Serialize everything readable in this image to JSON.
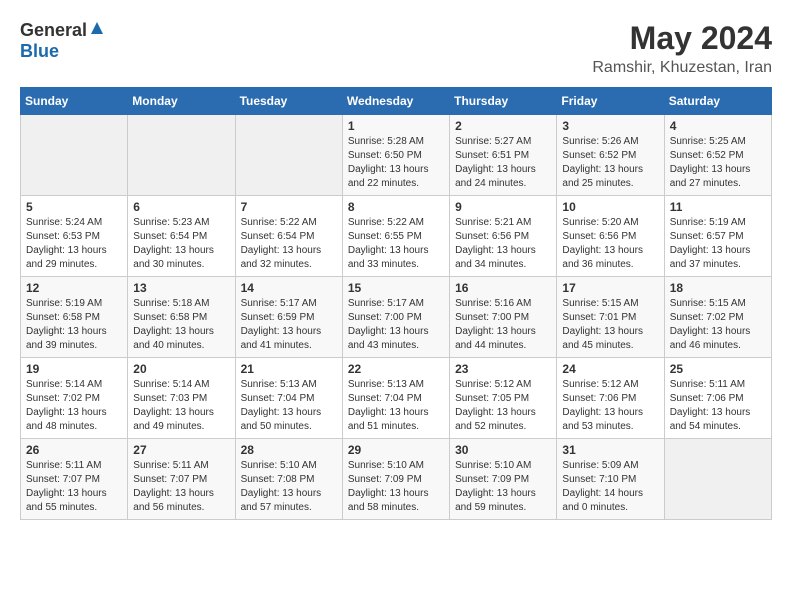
{
  "logo": {
    "general": "General",
    "blue": "Blue"
  },
  "title": "May 2024",
  "location": "Ramshir, Khuzestan, Iran",
  "headers": [
    "Sunday",
    "Monday",
    "Tuesday",
    "Wednesday",
    "Thursday",
    "Friday",
    "Saturday"
  ],
  "weeks": [
    [
      {
        "day": "",
        "info": ""
      },
      {
        "day": "",
        "info": ""
      },
      {
        "day": "",
        "info": ""
      },
      {
        "day": "1",
        "info": "Sunrise: 5:28 AM\nSunset: 6:50 PM\nDaylight: 13 hours\nand 22 minutes."
      },
      {
        "day": "2",
        "info": "Sunrise: 5:27 AM\nSunset: 6:51 PM\nDaylight: 13 hours\nand 24 minutes."
      },
      {
        "day": "3",
        "info": "Sunrise: 5:26 AM\nSunset: 6:52 PM\nDaylight: 13 hours\nand 25 minutes."
      },
      {
        "day": "4",
        "info": "Sunrise: 5:25 AM\nSunset: 6:52 PM\nDaylight: 13 hours\nand 27 minutes."
      }
    ],
    [
      {
        "day": "5",
        "info": "Sunrise: 5:24 AM\nSunset: 6:53 PM\nDaylight: 13 hours\nand 29 minutes."
      },
      {
        "day": "6",
        "info": "Sunrise: 5:23 AM\nSunset: 6:54 PM\nDaylight: 13 hours\nand 30 minutes."
      },
      {
        "day": "7",
        "info": "Sunrise: 5:22 AM\nSunset: 6:54 PM\nDaylight: 13 hours\nand 32 minutes."
      },
      {
        "day": "8",
        "info": "Sunrise: 5:22 AM\nSunset: 6:55 PM\nDaylight: 13 hours\nand 33 minutes."
      },
      {
        "day": "9",
        "info": "Sunrise: 5:21 AM\nSunset: 6:56 PM\nDaylight: 13 hours\nand 34 minutes."
      },
      {
        "day": "10",
        "info": "Sunrise: 5:20 AM\nSunset: 6:56 PM\nDaylight: 13 hours\nand 36 minutes."
      },
      {
        "day": "11",
        "info": "Sunrise: 5:19 AM\nSunset: 6:57 PM\nDaylight: 13 hours\nand 37 minutes."
      }
    ],
    [
      {
        "day": "12",
        "info": "Sunrise: 5:19 AM\nSunset: 6:58 PM\nDaylight: 13 hours\nand 39 minutes."
      },
      {
        "day": "13",
        "info": "Sunrise: 5:18 AM\nSunset: 6:58 PM\nDaylight: 13 hours\nand 40 minutes."
      },
      {
        "day": "14",
        "info": "Sunrise: 5:17 AM\nSunset: 6:59 PM\nDaylight: 13 hours\nand 41 minutes."
      },
      {
        "day": "15",
        "info": "Sunrise: 5:17 AM\nSunset: 7:00 PM\nDaylight: 13 hours\nand 43 minutes."
      },
      {
        "day": "16",
        "info": "Sunrise: 5:16 AM\nSunset: 7:00 PM\nDaylight: 13 hours\nand 44 minutes."
      },
      {
        "day": "17",
        "info": "Sunrise: 5:15 AM\nSunset: 7:01 PM\nDaylight: 13 hours\nand 45 minutes."
      },
      {
        "day": "18",
        "info": "Sunrise: 5:15 AM\nSunset: 7:02 PM\nDaylight: 13 hours\nand 46 minutes."
      }
    ],
    [
      {
        "day": "19",
        "info": "Sunrise: 5:14 AM\nSunset: 7:02 PM\nDaylight: 13 hours\nand 48 minutes."
      },
      {
        "day": "20",
        "info": "Sunrise: 5:14 AM\nSunset: 7:03 PM\nDaylight: 13 hours\nand 49 minutes."
      },
      {
        "day": "21",
        "info": "Sunrise: 5:13 AM\nSunset: 7:04 PM\nDaylight: 13 hours\nand 50 minutes."
      },
      {
        "day": "22",
        "info": "Sunrise: 5:13 AM\nSunset: 7:04 PM\nDaylight: 13 hours\nand 51 minutes."
      },
      {
        "day": "23",
        "info": "Sunrise: 5:12 AM\nSunset: 7:05 PM\nDaylight: 13 hours\nand 52 minutes."
      },
      {
        "day": "24",
        "info": "Sunrise: 5:12 AM\nSunset: 7:06 PM\nDaylight: 13 hours\nand 53 minutes."
      },
      {
        "day": "25",
        "info": "Sunrise: 5:11 AM\nSunset: 7:06 PM\nDaylight: 13 hours\nand 54 minutes."
      }
    ],
    [
      {
        "day": "26",
        "info": "Sunrise: 5:11 AM\nSunset: 7:07 PM\nDaylight: 13 hours\nand 55 minutes."
      },
      {
        "day": "27",
        "info": "Sunrise: 5:11 AM\nSunset: 7:07 PM\nDaylight: 13 hours\nand 56 minutes."
      },
      {
        "day": "28",
        "info": "Sunrise: 5:10 AM\nSunset: 7:08 PM\nDaylight: 13 hours\nand 57 minutes."
      },
      {
        "day": "29",
        "info": "Sunrise: 5:10 AM\nSunset: 7:09 PM\nDaylight: 13 hours\nand 58 minutes."
      },
      {
        "day": "30",
        "info": "Sunrise: 5:10 AM\nSunset: 7:09 PM\nDaylight: 13 hours\nand 59 minutes."
      },
      {
        "day": "31",
        "info": "Sunrise: 5:09 AM\nSunset: 7:10 PM\nDaylight: 14 hours\nand 0 minutes."
      },
      {
        "day": "",
        "info": ""
      }
    ]
  ]
}
